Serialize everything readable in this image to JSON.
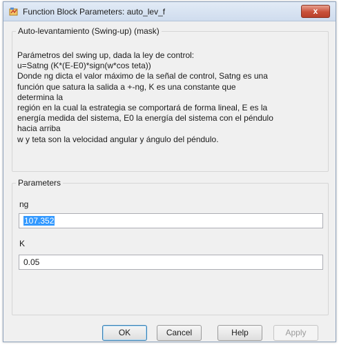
{
  "window": {
    "title": "Function Block Parameters: auto_lev_f",
    "close_label": "x"
  },
  "mask_group": {
    "title": "Auto-levantamiento (Swing-up) (mask)",
    "description_lines": [
      "Parámetros del swing up, dada la ley de control:",
      "u=Satng (K*(E-E0)*sign(w*cos teta))",
      "Donde ng dicta el valor máximo de la señal de control, Satng es una",
      "función que satura la salida a +-ng, K es una constante que",
      "determina la",
      "región en la cual la estrategia se comportará de forma lineal, E es la",
      "energía medida del sistema, E0 la energía del sistema con el péndulo",
      "hacia arriba",
      "w y teta son la velocidad angular y ángulo del péndulo."
    ]
  },
  "parameters_group": {
    "title": "Parameters",
    "ng_label": "ng",
    "ng_value": "107.352",
    "k_label": "K",
    "k_value": "0.05"
  },
  "buttons": {
    "ok": "OK",
    "cancel": "Cancel",
    "help": "Help",
    "apply": "Apply"
  }
}
